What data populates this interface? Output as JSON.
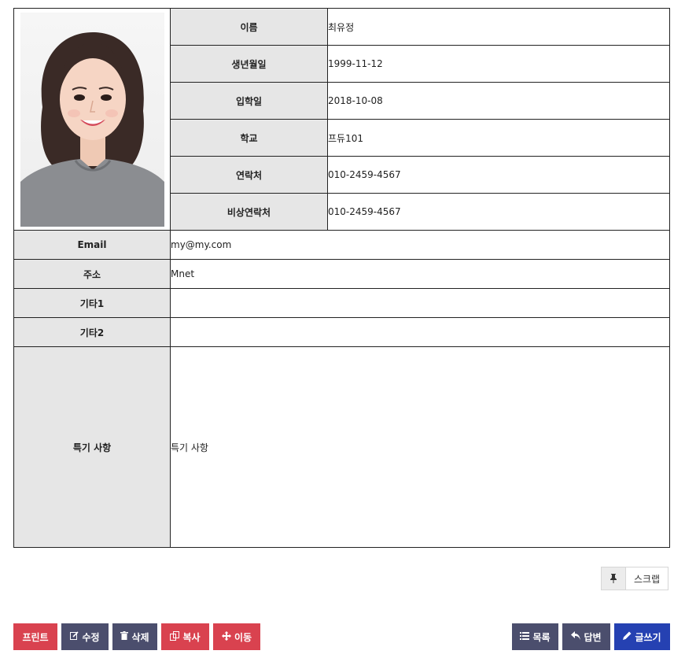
{
  "profile": {
    "name": {
      "label": "이름",
      "value": "최유정"
    },
    "birth": {
      "label": "생년월일",
      "value": "1999-11-12"
    },
    "admission": {
      "label": "입학일",
      "value": "2018-10-08"
    },
    "school": {
      "label": "학교",
      "value": "프듀101"
    },
    "contact": {
      "label": "연락처",
      "value": "010-2459-4567"
    },
    "emergency": {
      "label": "비상연락처",
      "value": "010-2459-4567"
    },
    "email": {
      "label": "Email",
      "value": "my@my.com"
    },
    "address": {
      "label": "주소",
      "value": "Mnet"
    },
    "etc1": {
      "label": "기타1",
      "value": ""
    },
    "etc2": {
      "label": "기타2",
      "value": ""
    },
    "memo": {
      "label": "특기 사항",
      "value": "특기 사항"
    }
  },
  "scrap": {
    "icon": "pin-icon",
    "label": "스크랩"
  },
  "actions": {
    "print": {
      "label": "프린트"
    },
    "edit": {
      "label": "수정",
      "icon": "edit-icon"
    },
    "delete": {
      "label": "삭제",
      "icon": "trash-icon"
    },
    "copy": {
      "label": "복사",
      "icon": "copy-icon"
    },
    "move": {
      "label": "이동",
      "icon": "move-icon"
    },
    "list": {
      "label": "목록",
      "icon": "list-icon"
    },
    "reply": {
      "label": "답변",
      "icon": "reply-icon"
    },
    "write": {
      "label": "글쓰기",
      "icon": "pencil-icon"
    }
  },
  "colors": {
    "red": "#d9424f",
    "slate": "#4b4e6d",
    "blue": "#2541b2",
    "label_bg": "#e6e6e6"
  }
}
